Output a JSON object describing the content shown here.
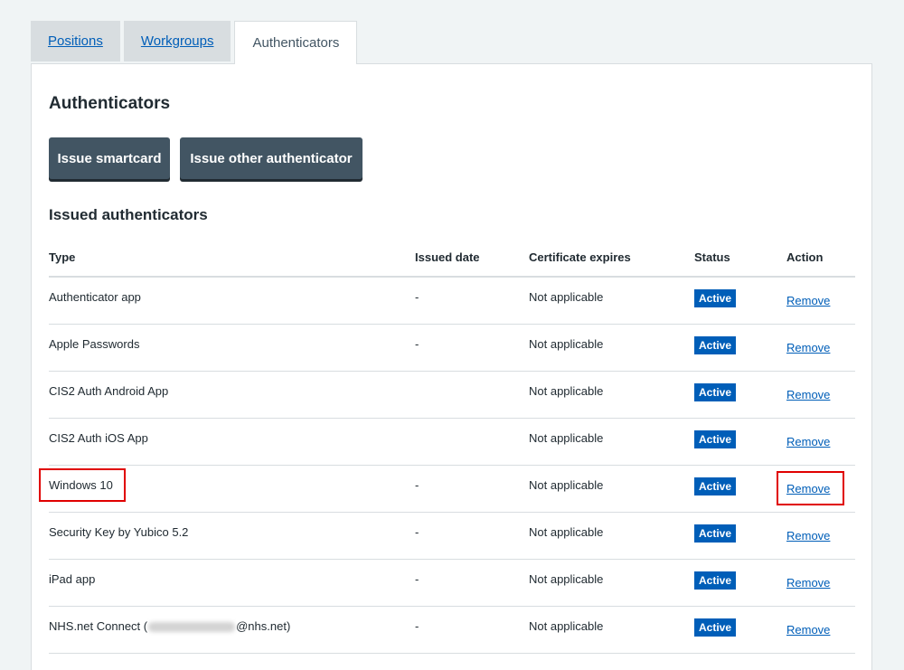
{
  "tabs": [
    {
      "label": "Positions"
    },
    {
      "label": "Workgroups"
    },
    {
      "label": "Authenticators"
    }
  ],
  "panel": {
    "title": "Authenticators",
    "buttons": {
      "issue_smartcard": "Issue smartcard",
      "issue_other": "Issue other authenticator"
    },
    "section_title": "Issued authenticators"
  },
  "table": {
    "headers": {
      "type": "Type",
      "issued_date": "Issued date",
      "certificate_expires": "Certificate expires",
      "status": "Status",
      "action": "Action"
    },
    "rows": [
      {
        "type": "Authenticator app",
        "issued_date": "-",
        "certificate_expires": "Not applicable",
        "status": "Active",
        "action": "Remove"
      },
      {
        "type": "Apple Passwords",
        "issued_date": "-",
        "certificate_expires": "Not applicable",
        "status": "Active",
        "action": "Remove"
      },
      {
        "type": "CIS2 Auth Android App",
        "issued_date": "",
        "certificate_expires": "Not applicable",
        "status": "Active",
        "action": "Remove"
      },
      {
        "type": "CIS2 Auth iOS App",
        "issued_date": "",
        "certificate_expires": "Not applicable",
        "status": "Active",
        "action": "Remove"
      },
      {
        "type": "Windows 10",
        "issued_date": "-",
        "certificate_expires": "Not applicable",
        "status": "Active",
        "action": "Remove"
      },
      {
        "type": "Security Key by Yubico 5.2",
        "issued_date": "-",
        "certificate_expires": "Not applicable",
        "status": "Active",
        "action": "Remove"
      },
      {
        "type": "iPad app",
        "issued_date": "-",
        "certificate_expires": "Not applicable",
        "status": "Active",
        "action": "Remove"
      },
      {
        "type_prefix": "NHS.net Connect (",
        "type_suffix": "@nhs.net)",
        "issued_date": "-",
        "certificate_expires": "Not applicable",
        "status": "Active",
        "action": "Remove"
      }
    ]
  },
  "colors": {
    "link": "#005eb8",
    "badge": "#005eb8",
    "button": "#425563",
    "highlight": "#e00000",
    "background": "#f0f4f5"
  }
}
